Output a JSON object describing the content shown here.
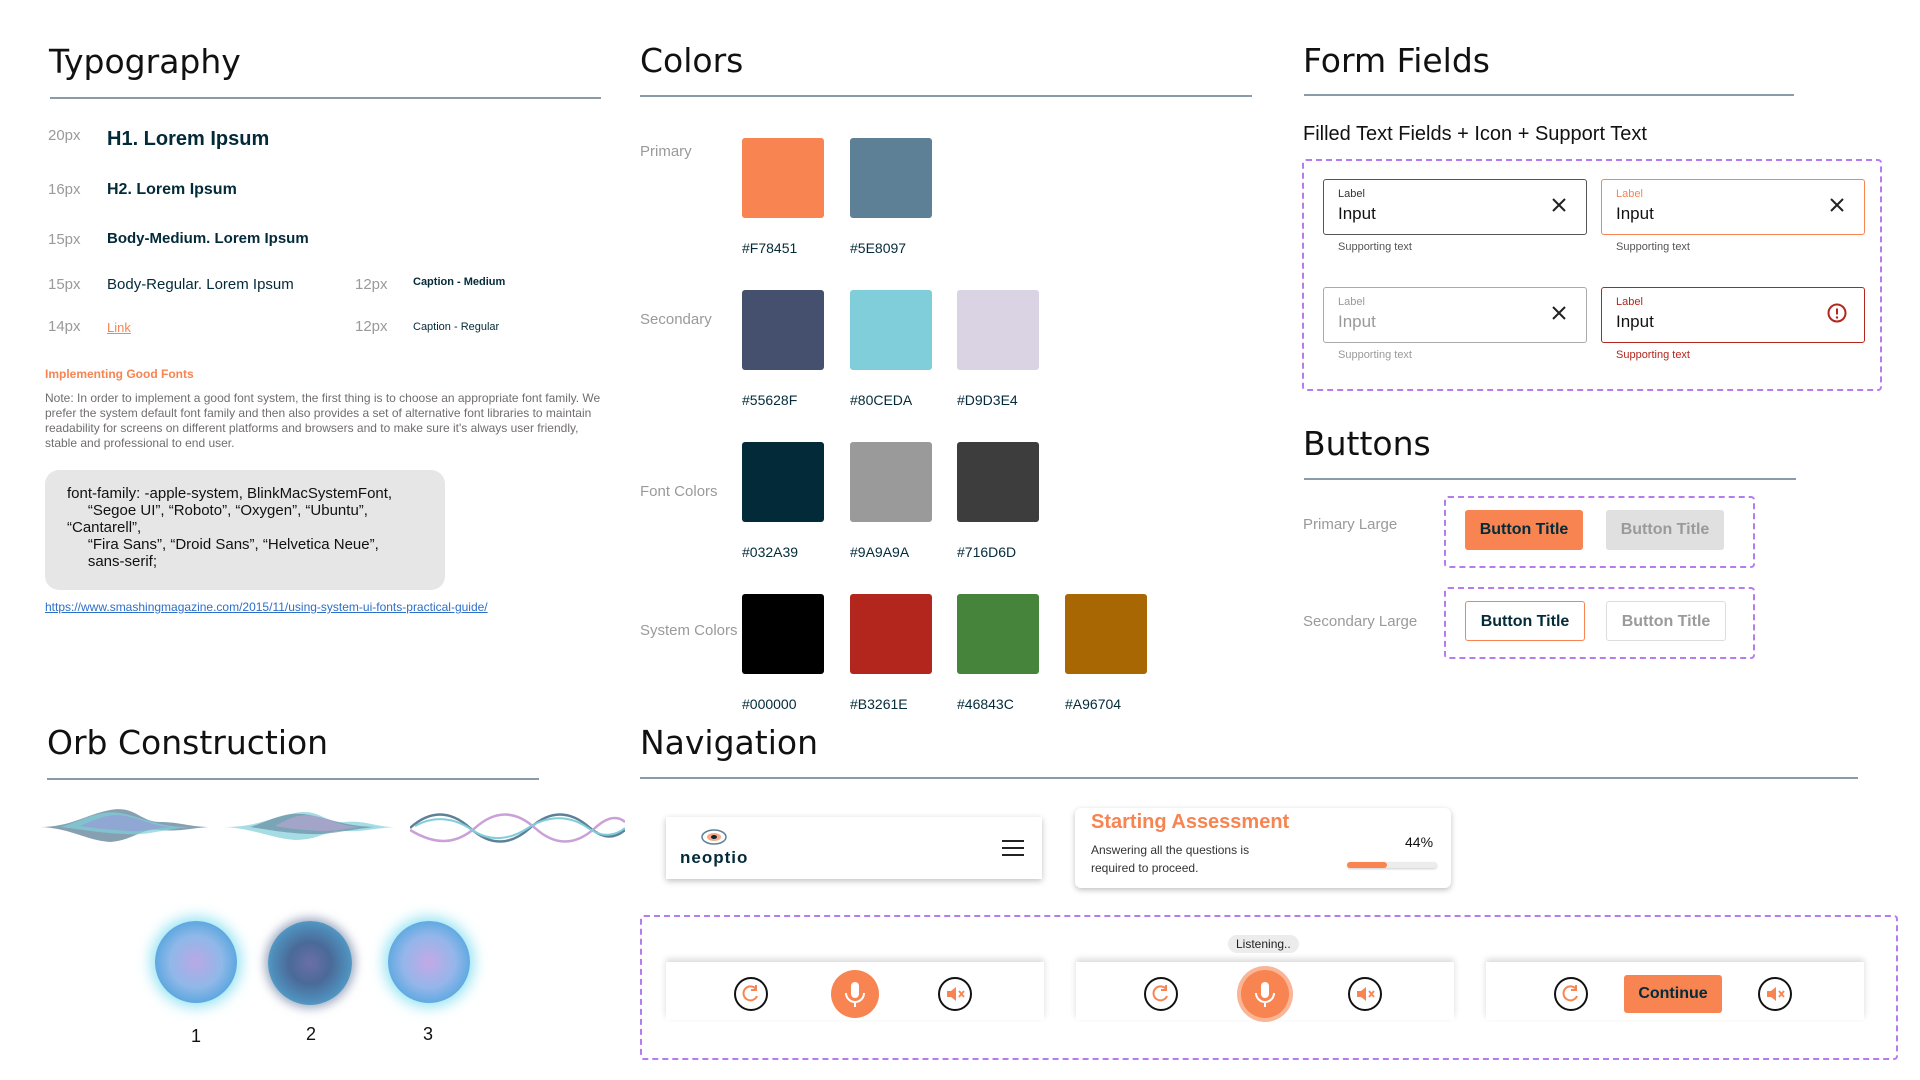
{
  "typography": {
    "title": "Typography",
    "rows": [
      {
        "size": "20px",
        "text": "H1. Lorem Ipsum"
      },
      {
        "size": "16px",
        "text": "H2. Lorem Ipsum"
      },
      {
        "size": "15px",
        "text": "Body-Medium. Lorem Ipsum"
      },
      {
        "size": "15px",
        "text": "Body-Regular. Lorem Ipsum"
      },
      {
        "size": "14px",
        "text": "Link"
      }
    ],
    "captions": [
      {
        "size": "12px",
        "text": "Caption - Medium"
      },
      {
        "size": "12px",
        "text": "Caption - Regular"
      }
    ],
    "note_title": "Implementing Good Fonts",
    "note": "Note: In order to implement a good font system, the first thing is to choose an appropriate font family. We prefer the system default font family and then also provides a set of alternative font libraries to maintain readability for screens on different platforms and browsers and to make sure it's always user friendly, stable and professional to end user.",
    "code": "font-family: -apple-system, BlinkMacSystemFont,\n     “Segoe UI”, “Roboto”, “Oxygen”, “Ubuntu”,\n“Cantarell”,\n     “Fira Sans”, “Droid Sans”, “Helvetica Neue”,\n     sans-serif;",
    "url": "https://www.smashingmagazine.com/2015/11/using-system-ui-fonts-practical-guide/"
  },
  "colors": {
    "title": "Colors",
    "groups": [
      {
        "label": "Primary",
        "swatches": [
          {
            "hex": "#F78451",
            "color": "#F78451"
          },
          {
            "hex": "#5E8097",
            "color": "#5E8097"
          }
        ]
      },
      {
        "label": "Secondary",
        "swatches": [
          {
            "hex": "#55628F",
            "color": "#45506F"
          },
          {
            "hex": "#80CEDA",
            "color": "#80CEDA"
          },
          {
            "hex": "#D9D3E4",
            "color": "#D9D3E4"
          }
        ]
      },
      {
        "label": "Font Colors",
        "swatches": [
          {
            "hex": "#032A39",
            "color": "#032A39"
          },
          {
            "hex": "#9A9A9A",
            "color": "#9A9A9A"
          },
          {
            "hex": "#716D6D",
            "color": "#3D3D3D"
          }
        ]
      },
      {
        "label": "System Colors",
        "swatches": [
          {
            "hex": "#000000",
            "color": "#000000"
          },
          {
            "hex": "#B3261E",
            "color": "#B3261E"
          },
          {
            "hex": "#46843C",
            "color": "#46843C"
          },
          {
            "hex": "#A96704",
            "color": "#A96704"
          }
        ]
      }
    ]
  },
  "form_fields": {
    "title": "Form Fields",
    "subtitle": "Filled Text Fields + Icon + Support Text",
    "fields": [
      {
        "label": "Label",
        "value": "Input",
        "support": "Supporting text",
        "state": "default"
      },
      {
        "label": "Label",
        "value": "Input",
        "support": "Supporting text",
        "state": "focused"
      },
      {
        "label": "Label",
        "value": "Input",
        "support": "Supporting text",
        "state": "disabled"
      },
      {
        "label": "Label",
        "value": "Input",
        "support": "Supporting text",
        "state": "error"
      }
    ]
  },
  "buttons": {
    "title": "Buttons",
    "rows": [
      {
        "label": "Primary Large",
        "enabled": "Button Title",
        "disabled": "Button Title"
      },
      {
        "label": "Secondary Large",
        "enabled": "Button Title",
        "disabled": "Button Title"
      }
    ]
  },
  "orb": {
    "title": "Orb Construction",
    "numbers": [
      "1",
      "2",
      "3"
    ]
  },
  "navigation": {
    "title": "Navigation",
    "brand": "neoptio",
    "assessment_title": "Starting Assessment",
    "assessment_desc": "Answering all the questions is required to proceed.",
    "progress_text": "44%",
    "progress": 0.44,
    "listening": "Listening..",
    "continue": "Continue"
  },
  "palette": {
    "accent": "#F78451",
    "navy": "#032A39",
    "error": "#B3261E",
    "dashed": "#B57CF0"
  }
}
